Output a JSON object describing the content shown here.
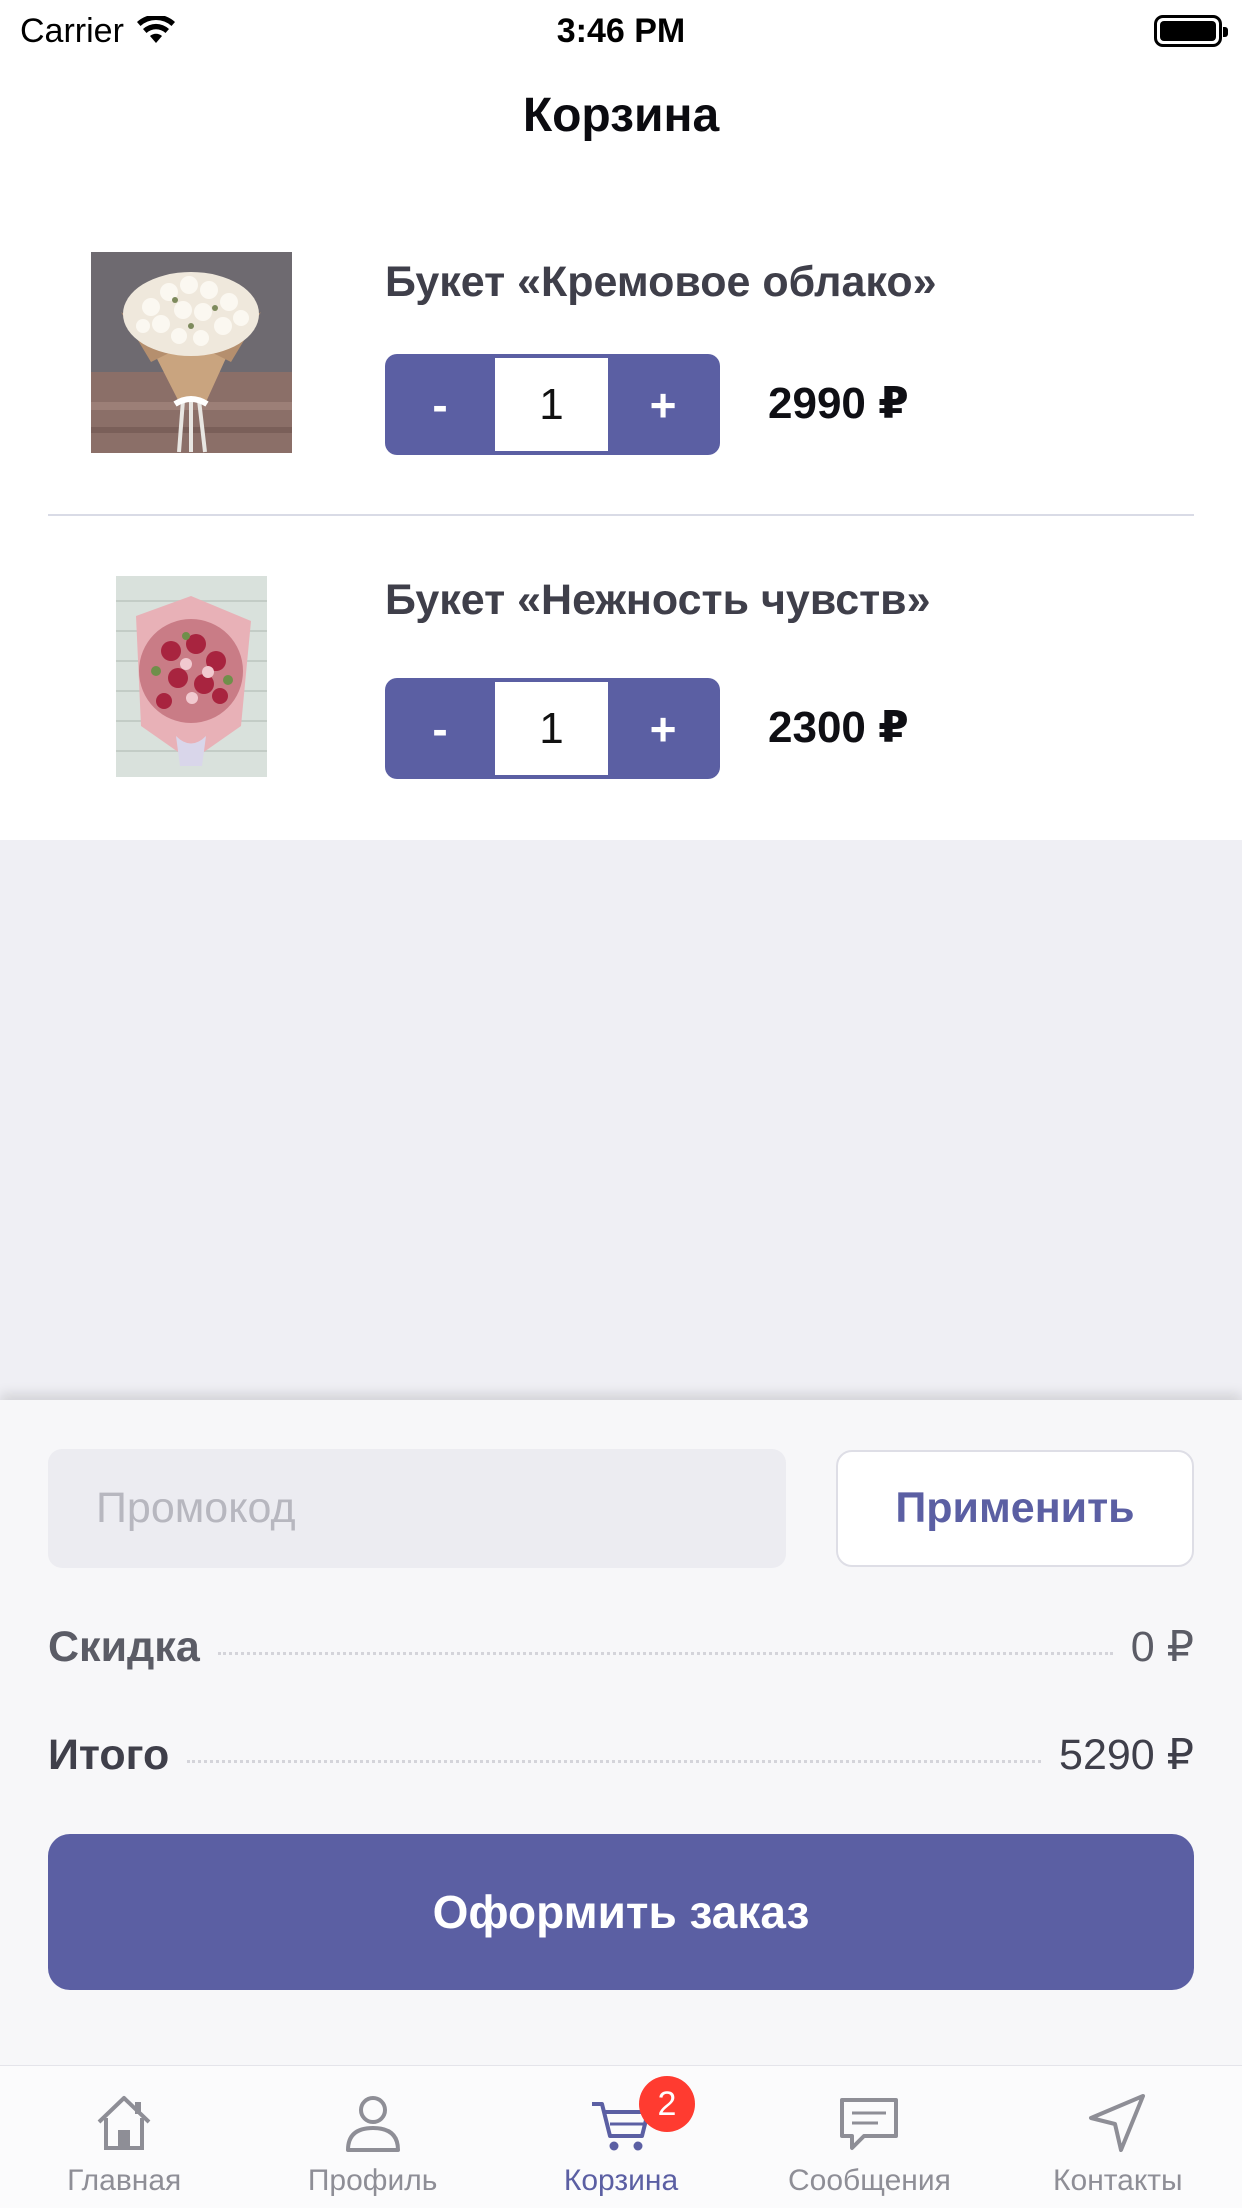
{
  "status_bar": {
    "carrier": "Carrier",
    "time": "3:46 PM"
  },
  "nav": {
    "title": "Корзина"
  },
  "cart": {
    "items": [
      {
        "title": "Букет «Кремовое облако»",
        "quantity": "1",
        "minus": "-",
        "plus": "+",
        "price": "2990 ₽"
      },
      {
        "title": "Букет «Нежность чувств»",
        "quantity": "1",
        "minus": "-",
        "plus": "+",
        "price": "2300 ₽"
      }
    ]
  },
  "summary": {
    "promo_placeholder": "Промокод",
    "apply_label": "Применить",
    "discount_label": "Скидка",
    "discount_value": "0 ₽",
    "total_label": "Итого",
    "total_value": "5290 ₽",
    "checkout_label": "Оформить заказ"
  },
  "tab_bar": {
    "tabs": [
      {
        "label": "Главная",
        "icon": "home-icon"
      },
      {
        "label": "Профиль",
        "icon": "profile-icon"
      },
      {
        "label": "Корзина",
        "icon": "cart-icon",
        "badge": "2",
        "active": true
      },
      {
        "label": "Сообщения",
        "icon": "messages-icon"
      },
      {
        "label": "Контакты",
        "icon": "location-arrow-icon"
      }
    ]
  },
  "colors": {
    "accent": "#5b5fa3",
    "badge": "#ff3b30",
    "background": "#efeff4"
  }
}
